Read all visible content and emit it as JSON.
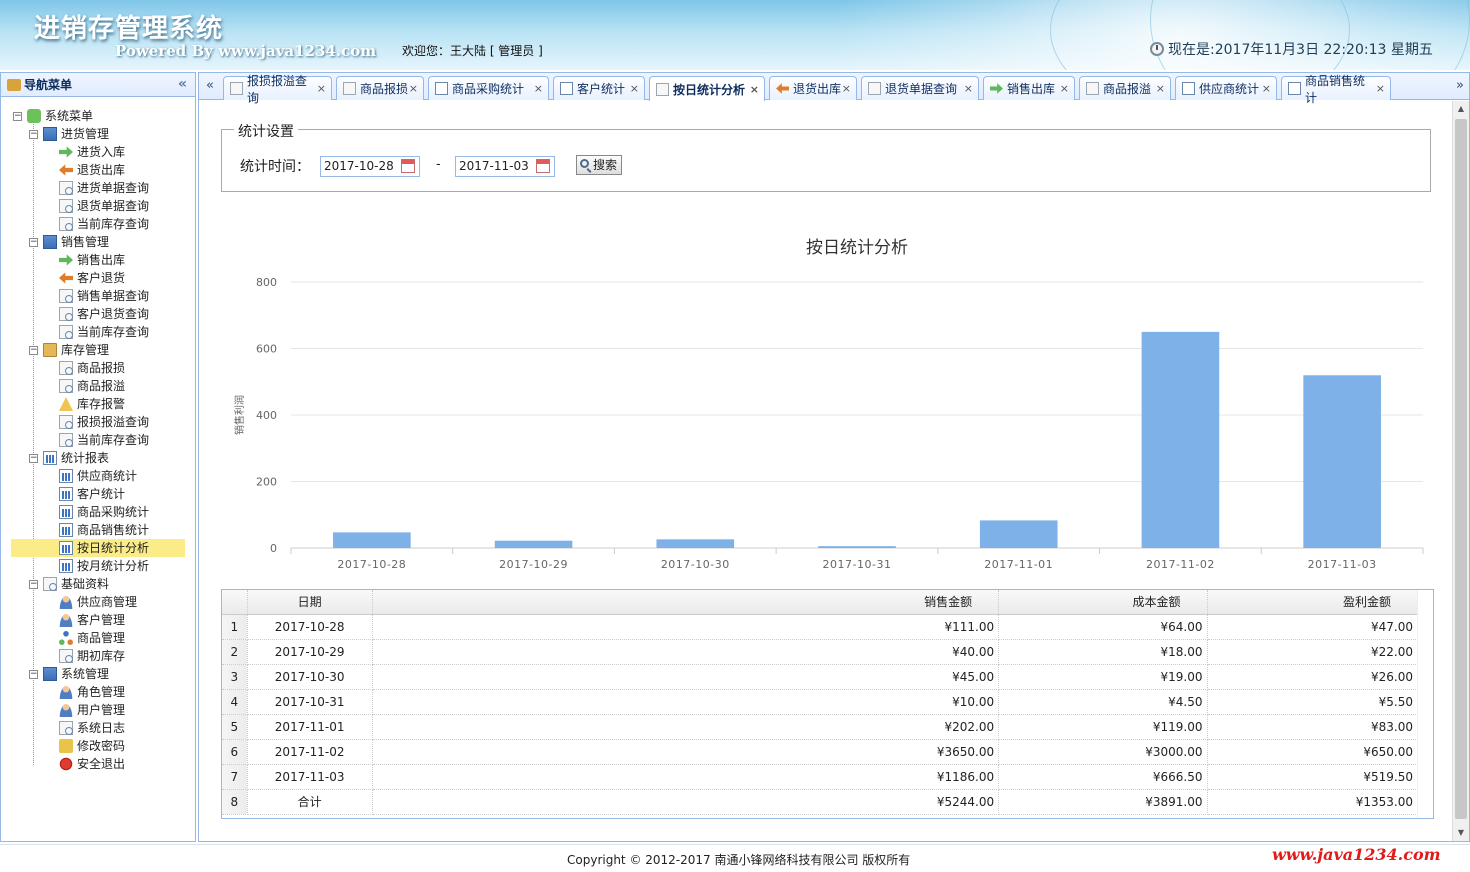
{
  "header": {
    "app_title": "进销存管理系统",
    "powered_by": "Powered By www.java1234.com",
    "welcome": "欢迎您：王大陆 [ 管理员 ]",
    "clock": "现在是:2017年11月3日 22:20:13 星期五"
  },
  "nav": {
    "title": "导航菜单",
    "collapse_glyph": "«",
    "root": "系统菜单",
    "groups": [
      {
        "label": "进货管理",
        "items": [
          "进货入库",
          "退货出库",
          "进货单据查询",
          "退货单据查询",
          "当前库存查询"
        ]
      },
      {
        "label": "销售管理",
        "items": [
          "销售出库",
          "客户退货",
          "销售单据查询",
          "客户退货查询",
          "当前库存查询"
        ]
      },
      {
        "label": "库存管理",
        "items": [
          "商品报损",
          "商品报溢",
          "库存报警",
          "报损报溢查询",
          "当前库存查询"
        ]
      },
      {
        "label": "统计报表",
        "items": [
          "供应商统计",
          "客户统计",
          "商品采购统计",
          "商品销售统计",
          "按日统计分析",
          "按月统计分析"
        ]
      },
      {
        "label": "基础资料",
        "items": [
          "供应商管理",
          "客户管理",
          "商品管理",
          "期初库存"
        ]
      },
      {
        "label": "系统管理",
        "items": [
          "角色管理",
          "用户管理",
          "系统日志",
          "修改密码",
          "安全退出"
        ]
      }
    ],
    "selected": "按日统计分析"
  },
  "tabs": [
    {
      "label": "报损报溢查询",
      "icon": "search-doc-icon"
    },
    {
      "label": "商品报损",
      "icon": "doc-icon"
    },
    {
      "label": "商品采购统计",
      "icon": "chart-icon"
    },
    {
      "label": "客户统计",
      "icon": "chart-icon"
    },
    {
      "label": "按日统计分析",
      "icon": "doc-icon",
      "active": true
    },
    {
      "label": "退货出库",
      "icon": "arrow-out-icon"
    },
    {
      "label": "退货单据查询",
      "icon": "search-doc-icon"
    },
    {
      "label": "销售出库",
      "icon": "arrow-in-icon"
    },
    {
      "label": "商品报溢",
      "icon": "doc-icon"
    },
    {
      "label": "供应商统计",
      "icon": "chart-icon"
    },
    {
      "label": "商品销售统计",
      "icon": "chart-icon"
    }
  ],
  "tab_close_glyph": "×",
  "tab_scroll_left": "«",
  "tab_scroll_right": "»",
  "filter": {
    "legend": "统计设置",
    "time_label": "统计时间：",
    "start_date": "2017-10-28",
    "separator": "-",
    "end_date": "2017-11-03",
    "search_label": "搜索"
  },
  "chart_data": {
    "type": "bar",
    "title": "按日统计分析",
    "ylabel": "销售利润",
    "xlabel": "",
    "categories": [
      "2017-10-28",
      "2017-10-29",
      "2017-10-30",
      "2017-10-31",
      "2017-11-01",
      "2017-11-02",
      "2017-11-03"
    ],
    "values": [
      47,
      22,
      26,
      5.5,
      83,
      650,
      519.5
    ],
    "ylim": [
      0,
      800
    ],
    "yticks": [
      0,
      200,
      400,
      600,
      800
    ],
    "color": "#7db1e8",
    "grid": true
  },
  "table": {
    "columns": [
      "日期",
      "销售金额",
      "成本金额",
      "盈利金额"
    ],
    "rows": [
      {
        "n": "1",
        "date": "2017-10-28",
        "sale": "¥111.00",
        "cost": "¥64.00",
        "profit": "¥47.00"
      },
      {
        "n": "2",
        "date": "2017-10-29",
        "sale": "¥40.00",
        "cost": "¥18.00",
        "profit": "¥22.00"
      },
      {
        "n": "3",
        "date": "2017-10-30",
        "sale": "¥45.00",
        "cost": "¥19.00",
        "profit": "¥26.00"
      },
      {
        "n": "4",
        "date": "2017-10-31",
        "sale": "¥10.00",
        "cost": "¥4.50",
        "profit": "¥5.50"
      },
      {
        "n": "5",
        "date": "2017-11-01",
        "sale": "¥202.00",
        "cost": "¥119.00",
        "profit": "¥83.00"
      },
      {
        "n": "6",
        "date": "2017-11-02",
        "sale": "¥3650.00",
        "cost": "¥3000.00",
        "profit": "¥650.00"
      },
      {
        "n": "7",
        "date": "2017-11-03",
        "sale": "¥1186.00",
        "cost": "¥666.50",
        "profit": "¥519.50"
      },
      {
        "n": "8",
        "date": "合计",
        "sale": "¥5244.00",
        "cost": "¥3891.00",
        "profit": "¥1353.00"
      }
    ]
  },
  "footer": {
    "copyright": "Copyright © 2012-2017 南通小锋网络科技有限公司 版权所有",
    "watermark": "www.java1234.com"
  }
}
